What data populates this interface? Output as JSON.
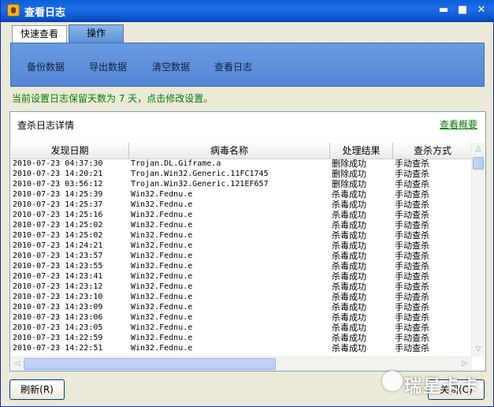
{
  "window": {
    "title": "查看日志",
    "min_glyph": "▬",
    "max_glyph": "■",
    "close_glyph": "✕"
  },
  "tabs": [
    {
      "label": "快速查看"
    },
    {
      "label": "操作"
    }
  ],
  "operations": [
    {
      "label": "备份数据"
    },
    {
      "label": "导出数据"
    },
    {
      "label": "清空数据"
    },
    {
      "label": "查看日志"
    }
  ],
  "notice": "当前设置日志保留天数为 7 天，点击修改设置。",
  "detail": {
    "title": "查杀日志详情",
    "summary_link": "查看概要"
  },
  "table": {
    "columns": [
      "发现日期",
      "病毒名称",
      "处理结果",
      "查杀方式"
    ],
    "rows": [
      [
        "2010-07-23 04:37:30",
        "Trojan.DL.Giframe.a",
        "删除成功",
        "手动查杀"
      ],
      [
        "2010-07-23 14:20:21",
        "Trojan.Win32.Generic.11FC1745",
        "删除成功",
        "手动查杀"
      ],
      [
        "2010-07-23 03:56:12",
        "Trojan.Win32.Generic.121EF657",
        "删除成功",
        "手动查杀"
      ],
      [
        "2010-07-23 14:25:39",
        "Win32.Fednu.e",
        "杀毒成功",
        "手动查杀"
      ],
      [
        "2010-07-23 14:25:37",
        "Win32.Fednu.e",
        "杀毒成功",
        "手动查杀"
      ],
      [
        "2010-07-23 14:25:16",
        "Win32.Fednu.e",
        "杀毒成功",
        "手动查杀"
      ],
      [
        "2010-07-23 14:25:02",
        "Win32.Fednu.e",
        "杀毒成功",
        "手动查杀"
      ],
      [
        "2010-07-23 14:25:02",
        "Win32.Fednu.e",
        "杀毒成功",
        "手动查杀"
      ],
      [
        "2010-07-23 14:24:21",
        "Win32.Fednu.e",
        "杀毒成功",
        "手动查杀"
      ],
      [
        "2010-07-23 14:23:57",
        "Win32.Fednu.e",
        "杀毒成功",
        "手动查杀"
      ],
      [
        "2010-07-23 14:23:55",
        "Win32.Fednu.e",
        "杀毒成功",
        "手动查杀"
      ],
      [
        "2010-07-23 14:23:41",
        "Win32.Fednu.e",
        "杀毒成功",
        "手动查杀"
      ],
      [
        "2010-07-23 14:23:12",
        "Win32.Fednu.e",
        "杀毒成功",
        "手动查杀"
      ],
      [
        "2010-07-23 14:23:10",
        "Win32.Fednu.e",
        "杀毒成功",
        "手动查杀"
      ],
      [
        "2010-07-23 14:23:09",
        "Win32.Fednu.e",
        "杀毒成功",
        "手动查杀"
      ],
      [
        "2010-07-23 14:23:06",
        "Win32.Fednu.e",
        "杀毒成功",
        "手动查杀"
      ],
      [
        "2010-07-23 14:23:05",
        "Win32.Fednu.e",
        "杀毒成功",
        "手动查杀"
      ],
      [
        "2010-07-23 14:22:59",
        "Win32.Fednu.e",
        "杀毒成功",
        "手动查杀"
      ],
      [
        "2010-07-23 14:22:51",
        "Win32.Fednu.e",
        "杀毒成功",
        "手动查杀"
      ]
    ]
  },
  "scrollbar": {
    "up": "△",
    "down": "▽",
    "left": "◁",
    "right": "▷"
  },
  "buttons": {
    "refresh": "刷新(R)",
    "close": "关闭(C)"
  },
  "watermark": {
    "text": "瑞星卡卡"
  }
}
